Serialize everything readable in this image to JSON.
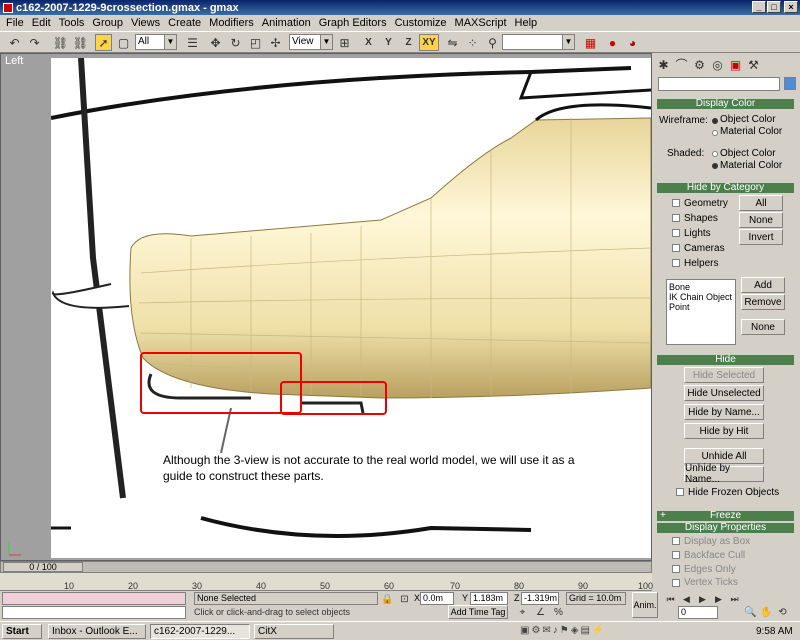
{
  "window": {
    "title": "c162-2007-1229-9crossection.gmax - gmax"
  },
  "menu": [
    "File",
    "Edit",
    "Tools",
    "Group",
    "Views",
    "Create",
    "Modifiers",
    "Animation",
    "Graph Editors",
    "Customize",
    "MAXScript",
    "Help"
  ],
  "toolbar": {
    "selection_filter": "All",
    "ref_coord": "View",
    "axis": "XY"
  },
  "viewport": {
    "label": "Left",
    "caption": "Although the 3-view is not accurate to the real world model, we will use it as a guide to construct these parts."
  },
  "display_color": {
    "title": "Display Color",
    "wireframe_label": "Wireframe:",
    "shaded_label": "Shaded:",
    "object_color": "Object Color",
    "material_color": "Material Color"
  },
  "hide_by_category": {
    "title": "Hide by Category",
    "checks": [
      "Geometry",
      "Shapes",
      "Lights",
      "Cameras",
      "Helpers"
    ],
    "all_button": "All",
    "none_button": "None",
    "invert_button": "Invert",
    "list": [
      "Bone",
      "IK Chain Object",
      "Point"
    ],
    "add_button": "Add",
    "remove_button": "Remove",
    "none2_button": "None"
  },
  "hide": {
    "title": "Hide",
    "hide_selected": "Hide Selected",
    "hide_unselected": "Hide Unselected",
    "hide_by_name": "Hide by Name...",
    "hide_by_hit": "Hide by Hit",
    "unhide_all": "Unhide All",
    "unhide_by_name": "Unhide by Name...",
    "hide_frozen": "Hide Frozen Objects"
  },
  "freeze": {
    "title": "Freeze"
  },
  "display_properties": {
    "title": "Display Properties",
    "items": [
      "Display as Box",
      "Backface Cull",
      "Edges Only",
      "Vertex Ticks"
    ]
  },
  "timeline": {
    "slider_label": "0 / 100",
    "ticks": [
      "10",
      "20",
      "30",
      "40",
      "50",
      "60",
      "70",
      "80",
      "90",
      "100"
    ]
  },
  "status": {
    "selection": "None Selected",
    "prompt": "Click or click-and-drag to select objects",
    "x_label": "X",
    "x_value": "0.0m",
    "y_label": "Y",
    "y_value": "1.183m",
    "z_label": "Z",
    "z_value": "-1.319m",
    "grid": "Grid = 10.0m",
    "add_time_tag": "Add Time Tag",
    "anim": "Anim.",
    "frame": "0"
  },
  "taskbar": {
    "start": "Start",
    "tasks": [
      "Inbox - Outlook E...",
      "c162-2007-1229...",
      "CitX"
    ],
    "clock": "9:58 AM"
  }
}
